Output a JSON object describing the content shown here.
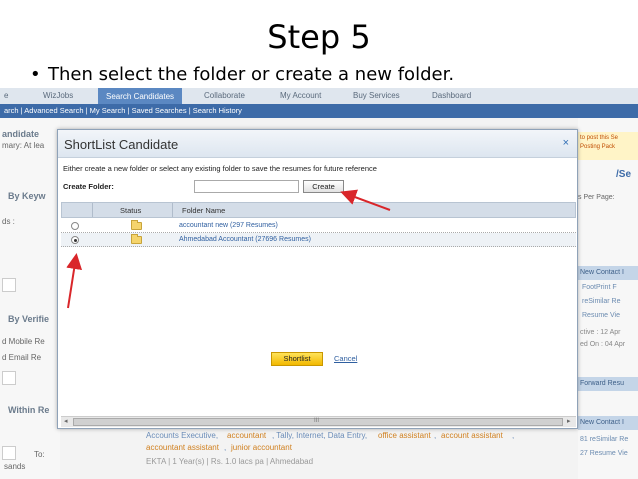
{
  "slide": {
    "title": "Step 5",
    "bullet": "Then select the folder or create a new folder."
  },
  "topnav": {
    "items": [
      "e",
      "WizJobs",
      "Search Candidates",
      "Collaborate",
      "My Account",
      "Buy Services",
      "Dashboard"
    ],
    "active": "Search Candidates"
  },
  "subnav": "arch | Advanced Search | My Search | Saved Searches | Search History",
  "background_left": {
    "candidate": "andidate",
    "summary": "mary: At lea",
    "by_keyword": "By Keyw",
    "words": "ds :",
    "by_verified": "By Verifie",
    "mobile": "d Mobile Re",
    "email": "d Email Re",
    "within": "Within Re",
    "to": "To:",
    "bottom_left": "sands",
    "lacs": "Lacs",
    "thousands": "Thousa"
  },
  "background_right": {
    "promo1": "to post this Se",
    "promo2": "Posting Pack",
    "se": "/Se",
    "per_page": "s Per Page:",
    "new_contact": "New Contact I",
    "footprint": "FootPrint F",
    "resimilar": "reSimilar Re",
    "resume_view": "Resume Vie",
    "active": "ctive : 12 Apr",
    "updated": "ed On : 04 Apr",
    "forward": "Forward Resu",
    "new_contact2": "New Contact I",
    "resimilar2": "81 reSimilar Re",
    "resume_view2": "27 Resume Vie"
  },
  "background_bottom": {
    "line1_parts": [
      "Accounts Executive,",
      "accountant",
      ", Tally, Internet, Data Entry,",
      "office assistant",
      ",",
      "account assistant",
      ","
    ],
    "line2_parts": [
      "accountant assistant",
      ",",
      "junior accountant"
    ],
    "line3": "EKTA  |  1 Year(s)  |  Rs. 1.0 lacs pa  |  Ahmedabad"
  },
  "dialog": {
    "title": "ShortList Candidate",
    "close": "×",
    "description": "Either create a new folder or select any existing folder to save the resumes for future reference",
    "create_folder_label": "Create Folder:",
    "create_folder_value": "",
    "create_button": "Create",
    "columns": [
      "Status",
      "Folder Name"
    ],
    "folders": [
      {
        "name": "accountant new (297 Resumes)",
        "selected": false
      },
      {
        "name": "Ahmedabad Accountant (27696 Resumes)",
        "selected": true
      }
    ],
    "shortlist_button": "Shortlist",
    "cancel_link": "Cancel",
    "scroll_label": "III"
  },
  "colors": {
    "accent_blue": "#3d6ba8",
    "arrow_red": "#d9262a",
    "shortlist_yellow": "#f2b800"
  }
}
